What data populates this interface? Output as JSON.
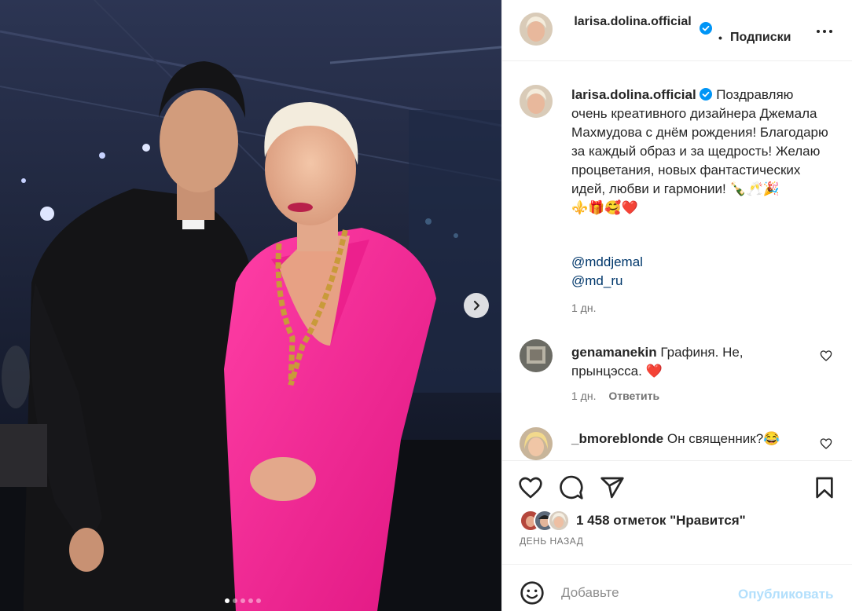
{
  "post": {
    "username": "larisa.dolina.official",
    "follow_label": "Подписки",
    "follow_separator": "•",
    "caption_text": "Поздравляю очень креативного дизайнера Джемала Махмудова с днём рождения! Благодарю за каждый образ и за щедрость! Желаю процветания, новых фантастических идей, любви и гармонии! 🍾🥂🎉",
    "caption_emojis": "⚜️🎁🥰❤️",
    "mentions": [
      "@mddjemal",
      "@md_ru"
    ],
    "caption_time": "1 дн."
  },
  "comments": [
    {
      "username": "genamanekin",
      "text": "Графиня. Не, прынцэсса. ❤️",
      "time": "1 дн.",
      "reply_label": "Ответить"
    },
    {
      "username": "_bmoreblonde",
      "text": "Он священник?😂"
    }
  ],
  "actions": {
    "likes_text": "1 458 отметок \"Нравится\"",
    "date_caps": "ДЕНЬ НАЗАД"
  },
  "composer": {
    "placeholder": "Добавьте",
    "publish_label": "Опубликовать"
  },
  "carousel": {
    "dot_count": 5,
    "active_index": 0
  },
  "colors": {
    "link": "#00376b",
    "verified": "#0095f6",
    "publish_disabled": "#b2dffc",
    "heart_red": "#ed1c24"
  },
  "icons": [
    "verified-badge-icon",
    "more-options-icon",
    "chevron-right-icon",
    "heart-icon",
    "comment-icon",
    "share-icon",
    "bookmark-icon",
    "emoji-icon"
  ]
}
